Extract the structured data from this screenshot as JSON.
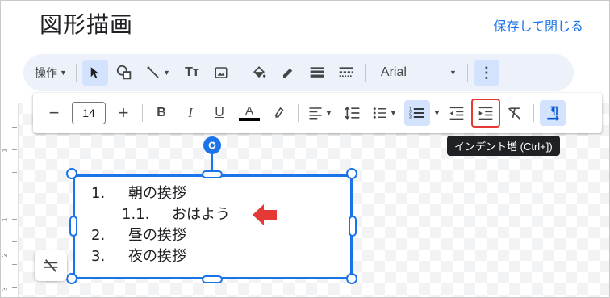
{
  "header": {
    "title": "図形描画",
    "save_close": "保存して閉じる"
  },
  "toolbar1": {
    "actions_label": "操作",
    "font_name": "Arial",
    "icons": [
      "caret-down-icon",
      "select-arrow-icon",
      "shape-icon",
      "line-icon",
      "text-box-icon",
      "image-icon",
      "fill-color-icon",
      "border-color-icon",
      "border-weight-icon",
      "border-dash-icon",
      "more-options-icon"
    ]
  },
  "toolbar2": {
    "font_size": "14",
    "minus": "−",
    "plus": "+",
    "bold": "B",
    "italic": "I",
    "underline": "U",
    "text_color_letter": "A",
    "text_color": "#000000",
    "accent": "#1a73e8",
    "red_highlight": "#e53935"
  },
  "tooltip": {
    "text": "インデント増 (Ctrl+])"
  },
  "ruler": {
    "labels": [
      "1",
      "1",
      "2",
      "3"
    ]
  },
  "textbox": {
    "items": [
      {
        "num": "1.",
        "text": "朝の挨拶"
      },
      {
        "num": "1.1.",
        "text": "おはよう"
      },
      {
        "num": "2.",
        "text": "昼の挨拶"
      },
      {
        "num": "3.",
        "text": "夜の挨拶"
      }
    ]
  }
}
